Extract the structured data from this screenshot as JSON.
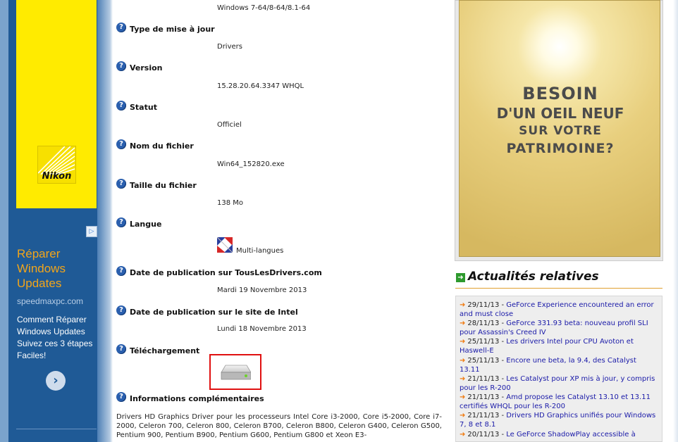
{
  "sidebar": {
    "nikon_label": "Nikon",
    "ad_choice": "▷",
    "ad_title": "Réparer Windows Updates",
    "ad_domain": "speedmaxpc.com",
    "ad_body": "Comment Réparer Windows Updates Suivez ces 3 étapes Faciles!",
    "ad_arrow": "›"
  },
  "driver": {
    "os_value": "Windows 7-64/8-64/8.1-64",
    "fields": [
      {
        "label": "Type de mise à jour",
        "value": "Drivers"
      },
      {
        "label": "Version",
        "value": "15.28.20.64.3347 WHQL"
      },
      {
        "label": "Statut",
        "value": "Officiel"
      },
      {
        "label": "Nom du fichier",
        "value": "Win64_152820.exe"
      },
      {
        "label": "Taille du fichier",
        "value": "138 Mo"
      },
      {
        "label": "Langue",
        "value": "Multi-langues"
      },
      {
        "label": "Date de publication sur TousLesDrivers.com",
        "value": "Mardi 19 Novembre 2013"
      },
      {
        "label": "Date de publication sur le site de Intel",
        "value": "Lundi 18 Novembre 2013"
      },
      {
        "label": "Téléchargement",
        "value": ""
      },
      {
        "label": "Informations complémentaires",
        "value": ""
      }
    ],
    "info_icon": "?",
    "description": "Drivers HD Graphics Driver pour les processeurs Intel Core i3-2000, Core i5-2000, Core i7-2000, Celeron 700, Celeron 800, Celeron B700, Celeron B800, Celeron G400, Celeron G500, Pentium 900, Pentium B900, Pentium G600, Pentium G800 et Xeon E3-"
  },
  "banner": {
    "line1": "BESOIN",
    "line2": "D'UN OEIL NEUF",
    "line3": "SUR VOTRE",
    "line4": "PATRIMOINE?"
  },
  "news": {
    "title": "Actualités relatives",
    "items": [
      {
        "date": "29/11/13 - ",
        "text": "GeForce Experience encountered an error and must close"
      },
      {
        "date": "28/11/13 - ",
        "text": "GeForce 331.93 beta: nouveau profil SLI pour Assassin's Creed IV"
      },
      {
        "date": "25/11/13 - ",
        "text": "Les drivers Intel pour CPU Avoton et Haswell-E"
      },
      {
        "date": "25/11/13 - ",
        "text": "Encore une beta, la 9.4, des Catalyst 13.11"
      },
      {
        "date": "21/11/13 - ",
        "text": "Les Catalyst pour XP mis à jour, y compris pour les R-200"
      },
      {
        "date": "21/11/13 - ",
        "text": "Amd propose les Catalyst 13.10 et 13.11 certifiés WHQL pour les R-200"
      },
      {
        "date": "21/11/13 - ",
        "text": "Drivers HD Graphics unifiés pour Windows 7, 8 et 8.1"
      },
      {
        "date": "20/11/13 - ",
        "text": "Le GeForce ShadowPlay accessible à"
      }
    ]
  }
}
